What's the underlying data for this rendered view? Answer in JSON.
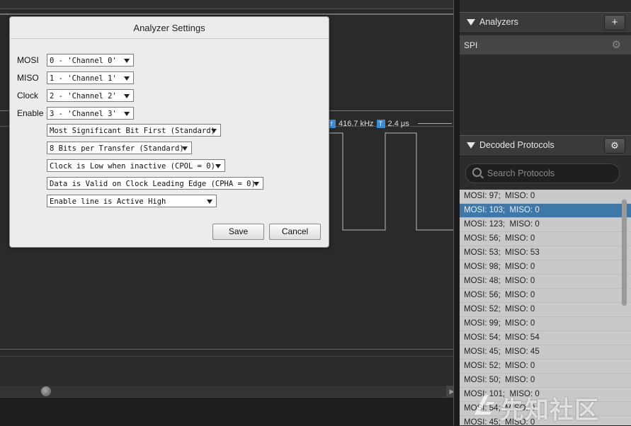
{
  "dialog": {
    "title": "Analyzer Settings",
    "fields": [
      {
        "label": "MOSI",
        "value": "0 - 'Channel 0'"
      },
      {
        "label": "MISO",
        "value": "1 - 'Channel 1'"
      },
      {
        "label": "Clock",
        "value": "2 - 'Channel 2'"
      },
      {
        "label": "Enable",
        "value": "3 - 'Channel 3'"
      }
    ],
    "options": [
      "Most Significant Bit First (Standard)",
      "8 Bits per Transfer (Standard)",
      "Clock is Low when inactive (CPOL = 0)",
      "Data is Valid on Clock Leading Edge (CPHA = 0)",
      "Enable line is Active High"
    ],
    "save_label": "Save",
    "cancel_label": "Cancel"
  },
  "measurements": {
    "frequency": "416.7 kHz",
    "period": "2.4 μs"
  },
  "analyzers": {
    "title": "Analyzers",
    "add_label": "+",
    "items": [
      {
        "name": "SPI"
      }
    ]
  },
  "decoded": {
    "title": "Decoded Protocols",
    "search_placeholder": "Search Protocols",
    "rows": [
      "MOSI: 97;  MISO: 0",
      "MOSI: 103;  MISO: 0",
      "MOSI: 123;  MISO: 0",
      "MOSI: 56;  MISO: 0",
      "MOSI: 53;  MISO: 53",
      "MOSI: 98;  MISO: 0",
      "MOSI: 48;  MISO: 0",
      "MOSI: 56;  MISO: 0",
      "MOSI: 52;  MISO: 0",
      "MOSI: 99;  MISO: 0",
      "MOSI: 54;  MISO: 54",
      "MOSI: 45;  MISO: 45",
      "MOSI: 52;  MISO: 0",
      "MOSI: 50;  MISO: 0",
      "MOSI: 101;  MISO: 0",
      "MOSI: 54;  MISO: 0",
      "MOSI: 45;  MISO: 0"
    ],
    "selected_index": 1
  },
  "watermark": "先知社区",
  "colors": {
    "selection": "#3d78a8",
    "measure_badge": "#3a8ad8"
  }
}
